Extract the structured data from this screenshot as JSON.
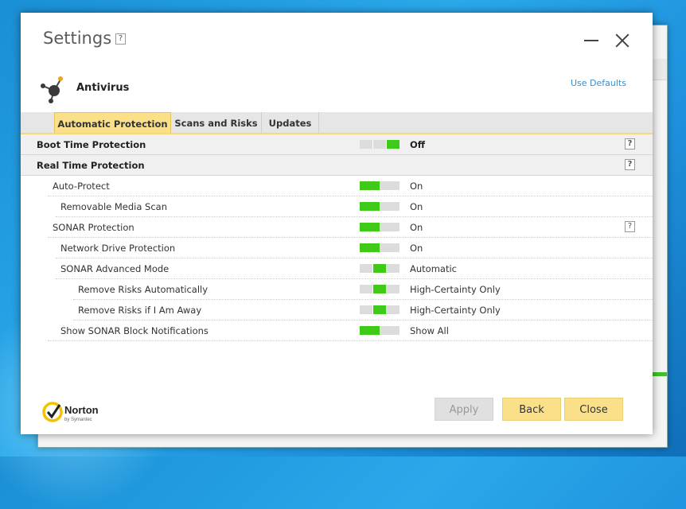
{
  "window": {
    "title": "Settings",
    "help": "?",
    "section_title": "Antivirus",
    "use_defaults": "Use Defaults"
  },
  "tabs": [
    {
      "label": "Automatic Protection",
      "active": true
    },
    {
      "label": "Scans and Risks",
      "active": false
    },
    {
      "label": "Updates",
      "active": false
    }
  ],
  "rows": [
    {
      "label": "Boot Time Protection",
      "value": "Off",
      "group": true,
      "help": "?"
    },
    {
      "label": "Real Time Protection",
      "value": "",
      "group": true,
      "help": "?"
    },
    {
      "label": "Auto-Protect",
      "value": "On"
    },
    {
      "label": "Removable Media Scan",
      "value": "On"
    },
    {
      "label": "SONAR Protection",
      "value": "On",
      "help": "?"
    },
    {
      "label": "Network Drive Protection",
      "value": "On"
    },
    {
      "label": "SONAR Advanced Mode",
      "value": "Automatic"
    },
    {
      "label": "Remove Risks Automatically",
      "value": "High-Certainty Only"
    },
    {
      "label": "Remove Risks if I Am Away",
      "value": "High-Certainty Only"
    },
    {
      "label": "Show SONAR Block Notifications",
      "value": "Show All"
    }
  ],
  "buttons": {
    "apply": "Apply",
    "back": "Back",
    "close": "Close"
  },
  "brand": {
    "name": "Norton",
    "sub": "by Symantec",
    "accent": "#fbe08a",
    "toggle_green": "#3fca18",
    "link_blue": "#3a8fc9"
  }
}
